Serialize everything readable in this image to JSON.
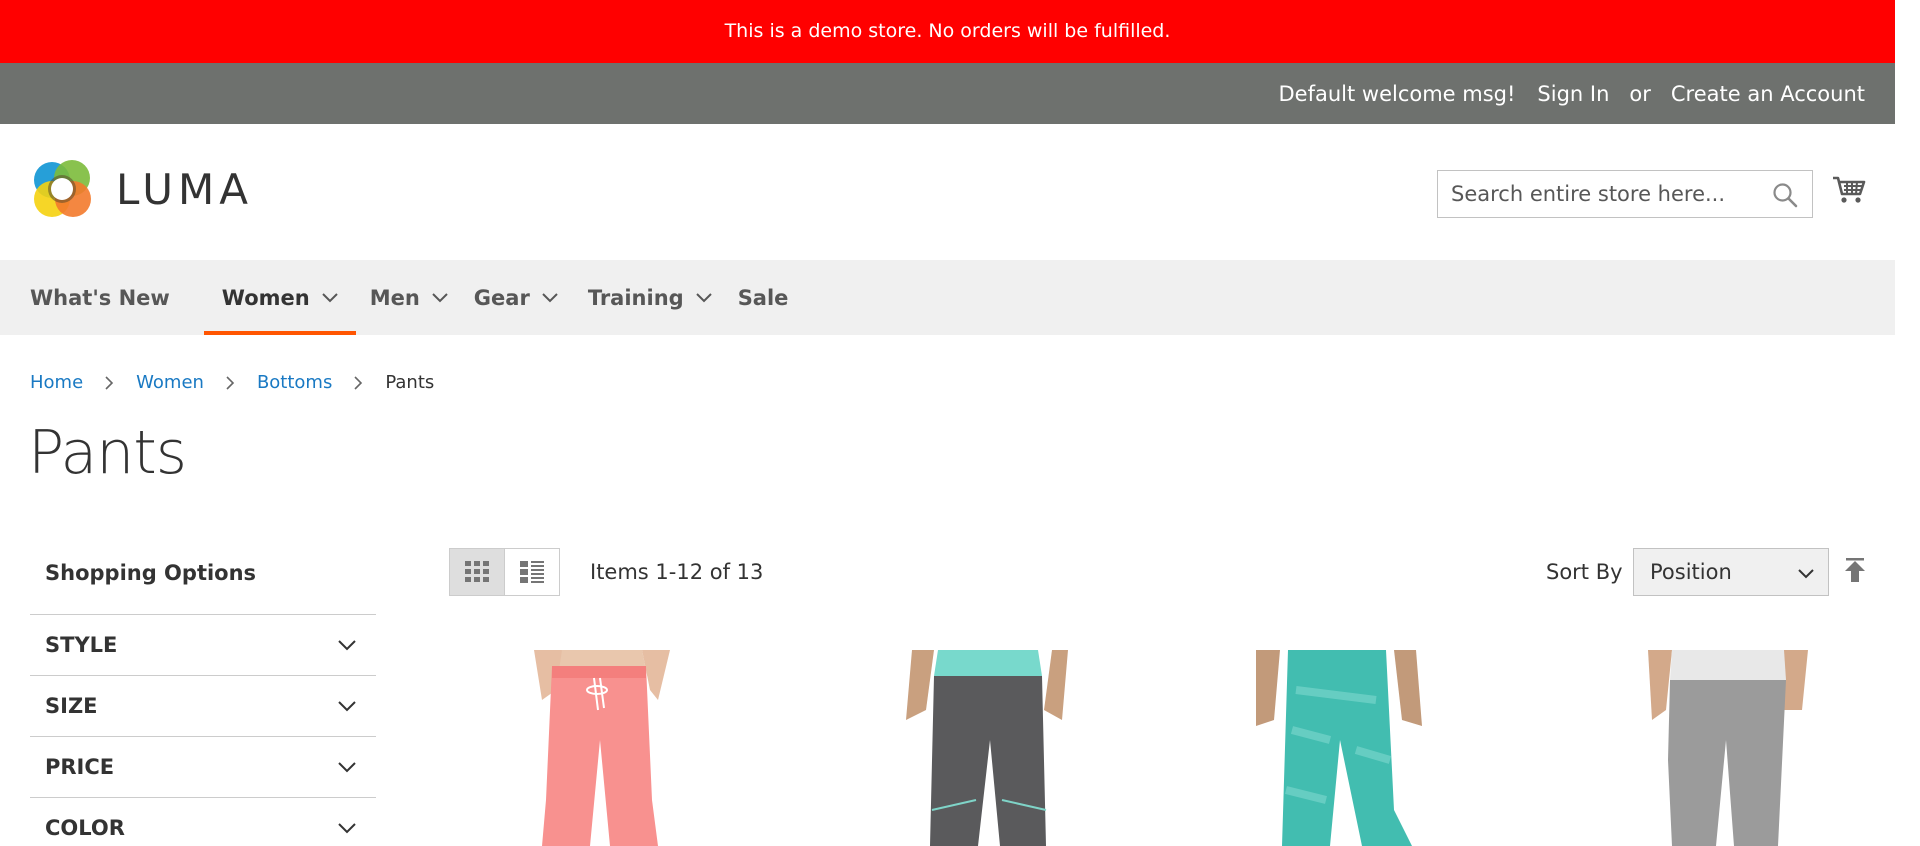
{
  "banner": {
    "text": "This is a demo store. No orders will be fulfilled."
  },
  "topbar": {
    "welcome": "Default welcome msg!",
    "sign_in": "Sign In",
    "or": "or",
    "create_account": "Create an Account"
  },
  "header": {
    "logo_text": "LUMA",
    "search_placeholder": "Search entire store here..."
  },
  "nav": {
    "items": [
      {
        "label": "What's New",
        "dropdown": false,
        "active": false
      },
      {
        "label": "Women",
        "dropdown": true,
        "active": true
      },
      {
        "label": "Men",
        "dropdown": true,
        "active": false
      },
      {
        "label": "Gear",
        "dropdown": true,
        "active": false
      },
      {
        "label": "Training",
        "dropdown": true,
        "active": false
      },
      {
        "label": "Sale",
        "dropdown": false,
        "active": false
      }
    ]
  },
  "breadcrumb": {
    "home": "Home",
    "women": "Women",
    "bottoms": "Bottoms",
    "current": "Pants"
  },
  "page_title": "Pants",
  "sidebar": {
    "title": "Shopping Options",
    "filters": [
      "STYLE",
      "SIZE",
      "PRICE",
      "COLOR"
    ]
  },
  "toolbar": {
    "amount": "Items 1-12 of 13",
    "sort_label": "Sort By",
    "sort_value": "Position"
  },
  "colors": {
    "banner": "#ff0000",
    "topbar": "#6e716e",
    "accent": "#ff5501",
    "link": "#1979c3",
    "nav_bg": "#f0f0f0"
  }
}
